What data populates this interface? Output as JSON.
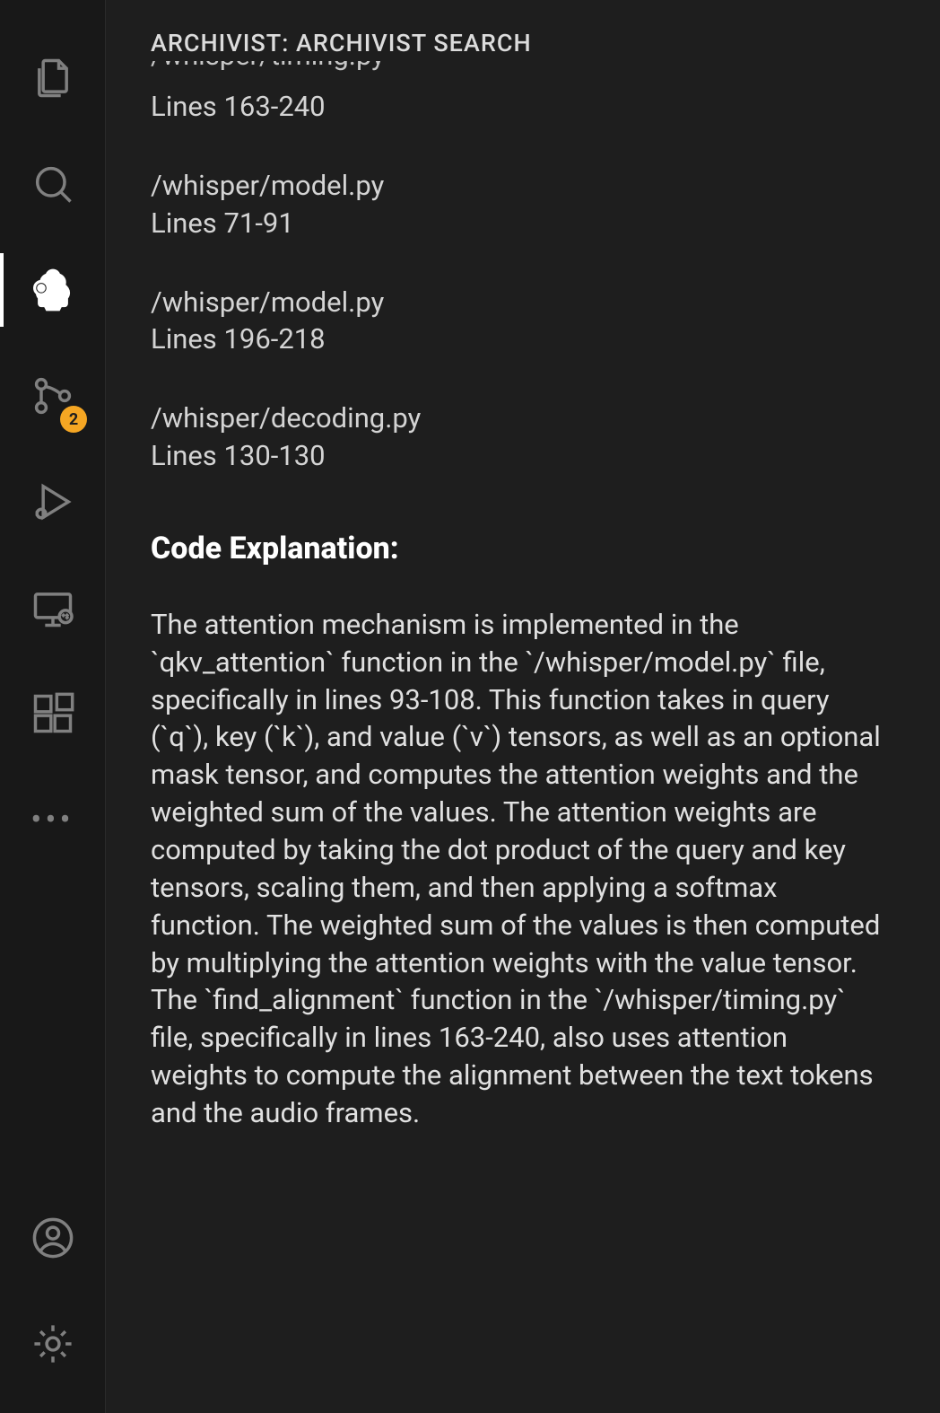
{
  "panel": {
    "title": "ARCHIVIST: ARCHIVIST SEARCH",
    "cutoff_path": "/whisper/timing.py",
    "results": [
      {
        "path": "",
        "lines": "Lines 163-240"
      },
      {
        "path": "/whisper/model.py",
        "lines": "Lines 71-91"
      },
      {
        "path": "/whisper/model.py",
        "lines": "Lines 196-218"
      },
      {
        "path": "/whisper/decoding.py",
        "lines": "Lines 130-130"
      }
    ],
    "section_heading": "Code Explanation:",
    "explanation": "The attention mechanism is implemented in the `qkv_attention` function in the `/whisper/model.py` file, specifically in lines 93-108. This function takes in query (`q`), key (`k`), and value (`v`) tensors, as well as an optional mask tensor, and computes the attention weights and the weighted sum of the values. The attention weights are computed by taking the dot product of the query and key tensors, scaling them, and then applying a softmax function. The weighted sum of the values is then computed by multiplying the attention weights with the value tensor. The `find_alignment` function in the `/whisper/timing.py` file, specifically in lines 163-240, also uses attention weights to compute the alignment between the text tokens and the audio frames."
  },
  "activity": {
    "source_control_badge": "2"
  }
}
